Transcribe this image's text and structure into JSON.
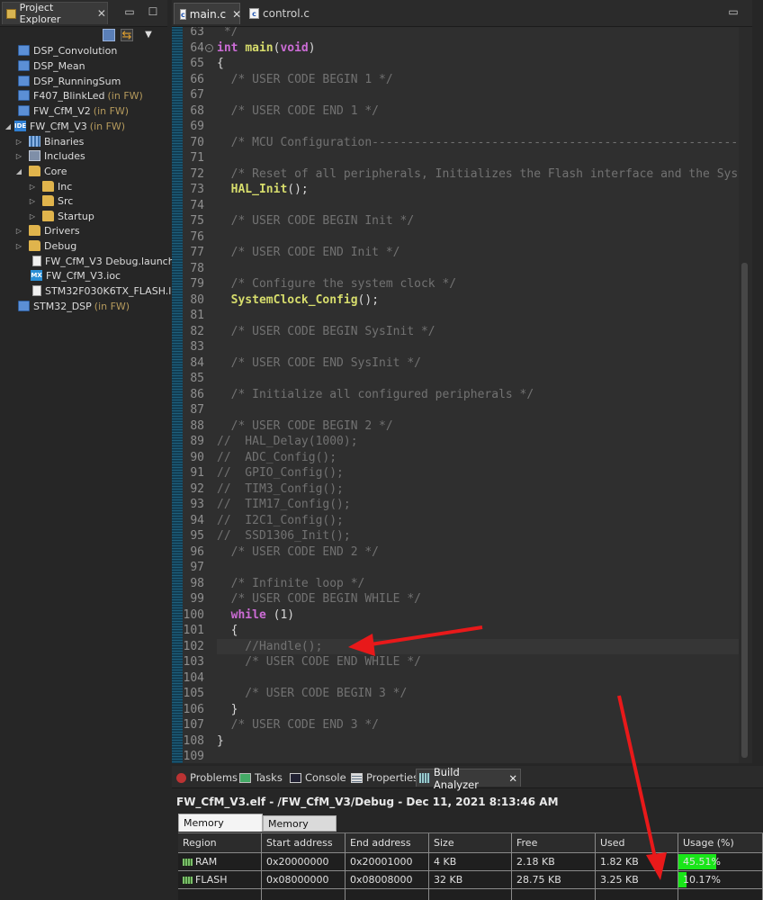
{
  "explorer": {
    "tab_label": "Project Explorer",
    "in_fw": "(in FW)",
    "items": [
      {
        "label": "DSP_Convolution",
        "in_fw": false
      },
      {
        "label": "DSP_Mean",
        "in_fw": false
      },
      {
        "label": "DSP_RunningSum",
        "in_fw": false
      },
      {
        "label": "F407_BlinkLed",
        "in_fw": true
      },
      {
        "label": "FW_CfM_V2",
        "in_fw": true
      },
      {
        "label": "FW_CfM_V3",
        "in_fw": true
      },
      {
        "label": "Binaries"
      },
      {
        "label": "Includes"
      },
      {
        "label": "Core"
      },
      {
        "label": "Inc"
      },
      {
        "label": "Src"
      },
      {
        "label": "Startup"
      },
      {
        "label": "Drivers"
      },
      {
        "label": "Debug"
      },
      {
        "label": "FW_CfM_V3 Debug.launch"
      },
      {
        "label": "FW_CfM_V3.ioc"
      },
      {
        "label": "STM32F030K6TX_FLASH.ld"
      },
      {
        "label": "STM32_DSP",
        "in_fw": true
      }
    ]
  },
  "editor": {
    "tabs": [
      {
        "label": "main.c",
        "active": true
      },
      {
        "label": "control.c",
        "active": false
      }
    ],
    "line_numbers": [
      "63",
      "64",
      "65",
      "66",
      "67",
      "68",
      "69",
      "70",
      "71",
      "72",
      "73",
      "74",
      "75",
      "76",
      "77",
      "78",
      "79",
      "80",
      "81",
      "82",
      "83",
      "84",
      "85",
      "86",
      "87",
      "88",
      "89",
      "90",
      "91",
      "92",
      "93",
      "94",
      "95",
      "96",
      "97",
      "98",
      "99",
      "100",
      "101",
      "102",
      "103",
      "104",
      "105",
      "106",
      "107",
      "108",
      "109"
    ],
    "current_line": "102",
    "code": [
      " */",
      "int main(void)",
      "{",
      "  /* USER CODE BEGIN 1 */",
      "",
      "  /* USER CODE END 1 */",
      "",
      "  /* MCU Configuration--------------------------------------------------------*/",
      "",
      "  /* Reset of all peripherals, Initializes the Flash interface and the Systick. */",
      "  HAL_Init();",
      "",
      "  /* USER CODE BEGIN Init */",
      "",
      "  /* USER CODE END Init */",
      "",
      "  /* Configure the system clock */",
      "  SystemClock_Config();",
      "",
      "  /* USER CODE BEGIN SysInit */",
      "",
      "  /* USER CODE END SysInit */",
      "",
      "  /* Initialize all configured peripherals */",
      "",
      "  /* USER CODE BEGIN 2 */",
      "//  HAL_Delay(1000);",
      "//  ADC_Config();",
      "//  GPIO_Config();",
      "//  TIM3_Config();",
      "//  TIM17_Config();",
      "//  I2C1_Config();",
      "//  SSD1306_Init();",
      "  /* USER CODE END 2 */",
      "",
      "  /* Infinite loop */",
      "  /* USER CODE BEGIN WHILE */",
      "  while (1)",
      "  {",
      "    //Handle();",
      "    /* USER CODE END WHILE */",
      "",
      "    /* USER CODE BEGIN 3 */",
      "  }",
      "  /* USER CODE END 3 */",
      "}",
      ""
    ]
  },
  "bottom_panel": {
    "tabs": [
      "Problems",
      "Tasks",
      "Console",
      "Properties",
      "Build Analyzer"
    ],
    "active_tab": "Build Analyzer",
    "title": "FW_CfM_V3.elf - /FW_CfM_V3/Debug - Dec 11, 2021 8:13:46 AM",
    "sub_tabs": [
      "Memory Regions",
      "Memory Details"
    ],
    "columns": [
      "Region",
      "Start address",
      "End address",
      "Size",
      "Free",
      "Used",
      "Usage (%)"
    ],
    "rows": [
      {
        "region": "RAM",
        "start": "0x20000000",
        "end": "0x20001000",
        "size": "4 KB",
        "free": "2.18 KB",
        "used": "1.82 KB",
        "usage_text": "45.51%",
        "usage": 45.51
      },
      {
        "region": "FLASH",
        "start": "0x08000000",
        "end": "0x08008000",
        "size": "32 KB",
        "free": "28.75 KB",
        "used": "3.25 KB",
        "usage_text": "10.17%",
        "usage": 10.17
      }
    ],
    "usage_color": "#19e619"
  },
  "annotation_color": "#e8191a"
}
